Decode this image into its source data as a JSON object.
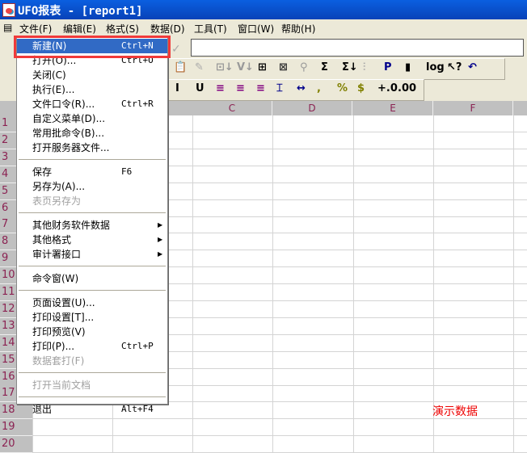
{
  "title": "UFO报表 - [report1]",
  "menubar": [
    "文件(F)",
    "编辑(E)",
    "格式(S)",
    "数据(D)",
    "工具(T)",
    "窗口(W)",
    "帮助(H)"
  ],
  "columns": [
    "C",
    "D",
    "E",
    "F"
  ],
  "rows": [
    "1",
    "2",
    "3",
    "4",
    "5",
    "6",
    "7",
    "8",
    "9",
    "10",
    "11",
    "12",
    "13",
    "14",
    "15",
    "16",
    "17",
    "18",
    "19",
    "20"
  ],
  "file_menu": [
    {
      "label": "新建(N)",
      "shortcut": "Ctrl+N",
      "selected": true
    },
    {
      "label": "打开(O)...",
      "shortcut": "Ctrl+O"
    },
    {
      "label": "关闭(C)"
    },
    {
      "label": "执行(E)..."
    },
    {
      "label": "文件口令(R)...",
      "shortcut": "Ctrl+R"
    },
    {
      "label": "自定义菜单(D)..."
    },
    {
      "label": "常用批命令(B)..."
    },
    {
      "label": "打开服务器文件..."
    },
    {
      "sep": true
    },
    {
      "label": "保存",
      "shortcut": "F6"
    },
    {
      "label": "另存为(A)..."
    },
    {
      "label": "表页另存为",
      "disabled": true
    },
    {
      "sep": true
    },
    {
      "label": "其他财务软件数据",
      "submenu": true
    },
    {
      "label": "其他格式",
      "submenu": true
    },
    {
      "label": "审计署接口",
      "submenu": true
    },
    {
      "sep": true
    },
    {
      "label": "命令窗(W)"
    },
    {
      "sep": true
    },
    {
      "label": "页面设置(U)..."
    },
    {
      "label": "打印设置[T]..."
    },
    {
      "label": "打印预览(V)"
    },
    {
      "label": "打印(P)...",
      "shortcut": "Ctrl+P"
    },
    {
      "label": "数据套打(F)",
      "disabled": true
    },
    {
      "sep": true
    },
    {
      "label": "打开当前文档",
      "disabled": true
    },
    {
      "sep": true
    },
    {
      "label": "退出",
      "shortcut": "Alt+F4"
    }
  ],
  "toolbar2": [
    "📋",
    "✎",
    "⊡↓",
    "V↓",
    "⊞",
    "⊠",
    "⚲",
    "Σ",
    "Σ↓",
    "⫶",
    "P",
    "▮",
    "log",
    "↖?",
    "↶"
  ],
  "toolbar3": [
    "I",
    "U",
    "≡",
    "≡",
    "≡",
    "⌶",
    "↔",
    ",",
    "%",
    "$",
    "+.0",
    ".00"
  ],
  "sheet_note": "演示数据"
}
